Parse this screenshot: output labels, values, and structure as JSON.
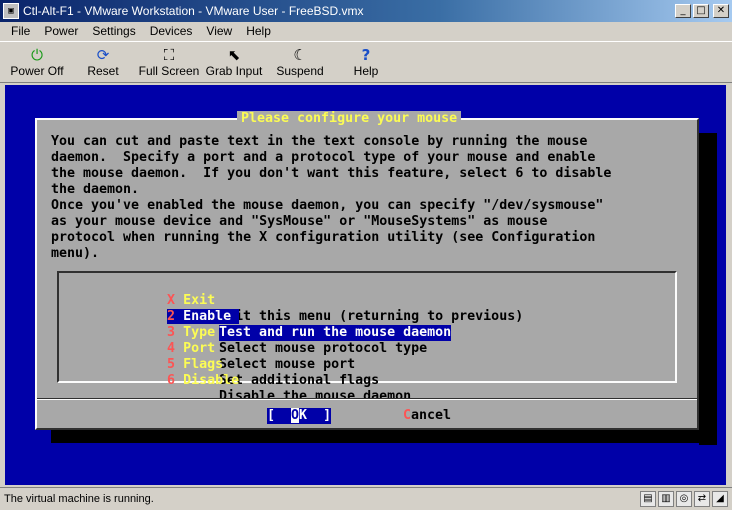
{
  "window": {
    "title": "Ctl-Alt-F1 - VMware Workstation - VMware User - FreeBSD.vmx",
    "minimize": "_",
    "maximize": "□",
    "close": "✕"
  },
  "menubar": [
    "File",
    "Power",
    "Settings",
    "Devices",
    "View",
    "Help"
  ],
  "toolbar": [
    {
      "label": "Power Off",
      "icon": "power-icon",
      "glyph": "⏻"
    },
    {
      "label": "Reset",
      "icon": "reset-icon",
      "glyph": "⟳"
    },
    {
      "label": "Full Screen",
      "icon": "fullscreen-icon",
      "glyph": "⛶"
    },
    {
      "label": "Grab Input",
      "icon": "pointer-icon",
      "glyph": "⬉"
    },
    {
      "label": "Suspend",
      "icon": "moon-icon",
      "glyph": "☾"
    },
    {
      "label": "Help",
      "icon": "help-icon",
      "glyph": "?"
    }
  ],
  "dialog": {
    "title": "Please configure your mouse",
    "body": "You can cut and paste text in the text console by running the mouse\ndaemon.  Specify a port and a protocol type of your mouse and enable\nthe mouse daemon.  If you don't want this feature, select 6 to disable\nthe daemon.\nOnce you've enabled the mouse daemon, you can specify \"/dev/sysmouse\"\nas your mouse device and \"SysMouse\" or \"MouseSystems\" as mouse\nprotocol when running the X configuration utility (see Configuration\nmenu).",
    "items": [
      {
        "key": "X",
        "name": "Exit",
        "desc": "Exit this menu (returning to previous)",
        "selected": false
      },
      {
        "key": "2",
        "name": "Enable",
        "desc": "Test and run the mouse daemon",
        "selected": true
      },
      {
        "key": "3",
        "name": "Type",
        "desc": "Select mouse protocol type",
        "selected": false
      },
      {
        "key": "4",
        "name": "Port",
        "desc": "Select mouse port",
        "selected": false
      },
      {
        "key": "5",
        "name": "Flags",
        "desc": "Set additional flags",
        "selected": false
      },
      {
        "key": "6",
        "name": "Disable",
        "desc": "Disable the mouse daemon",
        "selected": false
      }
    ],
    "ok": {
      "pre": "[  ",
      "hot": "O",
      "post": "K  ]"
    },
    "cancel": {
      "hot": "C",
      "rest": "ancel"
    }
  },
  "status": {
    "text": "The virtual machine is running."
  }
}
